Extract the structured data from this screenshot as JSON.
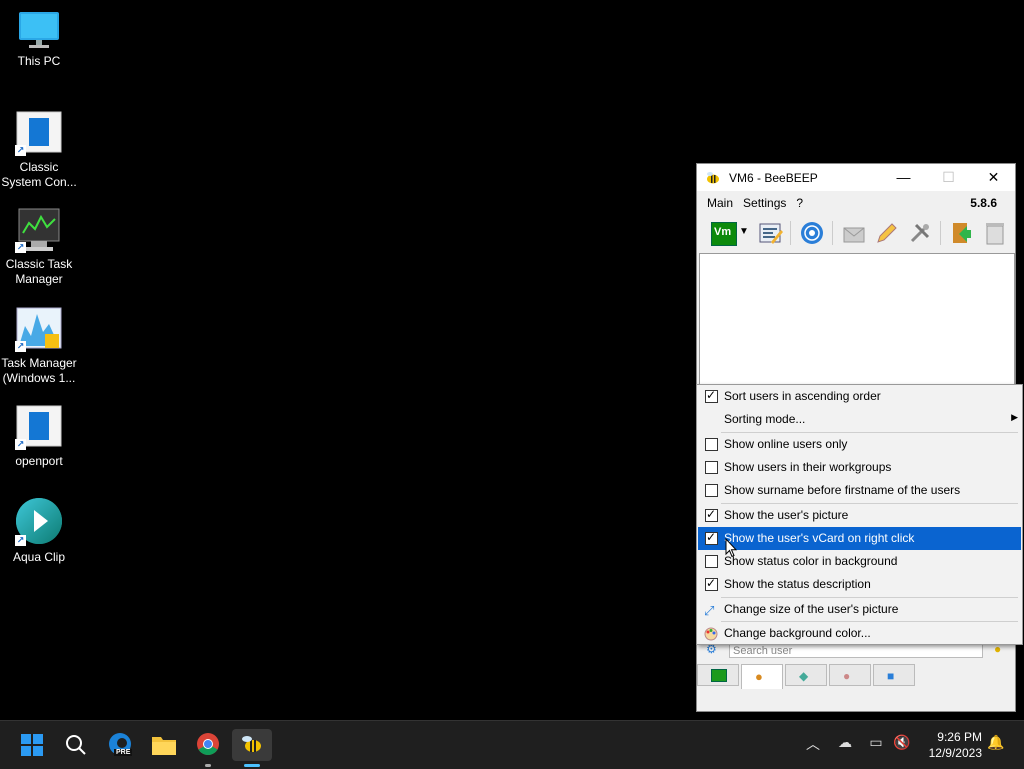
{
  "desktop": {
    "icons": [
      {
        "label_line1": "This PC",
        "label_line2": ""
      },
      {
        "label_line1": "Classic",
        "label_line2": "System Con..."
      },
      {
        "label_line1": "Classic Task",
        "label_line2": "Manager"
      },
      {
        "label_line1": "Task Manager",
        "label_line2": "(Windows 1..."
      },
      {
        "label_line1": "openport",
        "label_line2": ""
      },
      {
        "label_line1": "Aqua Clip",
        "label_line2": ""
      }
    ]
  },
  "window": {
    "title": "VM6 - BeeBEEP",
    "controls": {
      "minimize": "—",
      "maximize": "☐",
      "close": "✕"
    },
    "menu": [
      "Main",
      "Settings",
      "?"
    ],
    "version": "5.8.6",
    "toolbar_account": "Vm",
    "search_placeholder": "Search user"
  },
  "context_menu": {
    "items": [
      {
        "label": "Sort users in ascending order",
        "checkbox": true,
        "checked": true
      },
      {
        "label": "Sorting mode...",
        "checkbox": false,
        "submenu": true
      },
      {
        "label": "Show online users only",
        "checkbox": true,
        "checked": false
      },
      {
        "label": "Show users in their workgroups",
        "checkbox": true,
        "checked": false
      },
      {
        "label": "Show surname before firstname of the users",
        "checkbox": true,
        "checked": false
      },
      {
        "label": "Show the user's picture",
        "checkbox": true,
        "checked": true
      },
      {
        "label": "Show the user's vCard on right click",
        "checkbox": true,
        "checked": true,
        "highlighted": true
      },
      {
        "label": "Show status color in background",
        "checkbox": true,
        "checked": false
      },
      {
        "label": "Show the status description",
        "checkbox": true,
        "checked": true
      },
      {
        "label": "Change size of the user's picture",
        "icon": "resize-icon"
      },
      {
        "label": "Change background color...",
        "icon": "palette-icon"
      }
    ],
    "submenu_arrow": "▶",
    "highlight_color": "#0a64d0"
  },
  "taskbar": {
    "time": "9:26 PM",
    "date": "12/9/2023",
    "edge_badge": "PRE"
  }
}
